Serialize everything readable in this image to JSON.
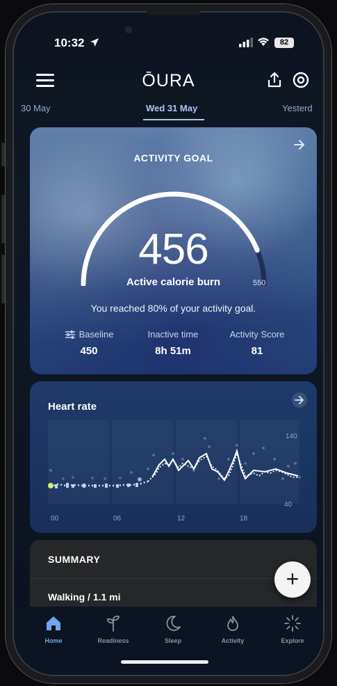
{
  "status_bar": {
    "time": "10:32",
    "battery": "82"
  },
  "header": {
    "logo": "ŌURA"
  },
  "dates": {
    "previous": "30 May",
    "current": "Wed 31 May",
    "next": "Yesterd"
  },
  "activity_goal": {
    "title": "ACTIVITY GOAL",
    "value": "456",
    "unit_label": "Active calorie burn",
    "min": "0",
    "max": "550",
    "progress": 0.83,
    "message": "You reached 80% of your activity goal.",
    "stats": [
      {
        "label": "Baseline",
        "value": "450"
      },
      {
        "label": "Inactive time",
        "value": "8h 51m"
      },
      {
        "label": "Activity Score",
        "value": "81"
      }
    ]
  },
  "heart_rate": {
    "title": "Heart rate",
    "y_max_label": "140",
    "y_min_label": "40",
    "x_labels": [
      "00",
      "06",
      "12",
      "18"
    ]
  },
  "summary": {
    "title": "SUMMARY",
    "row": "Walking / 1.1 mi"
  },
  "fab": {
    "label": "+"
  },
  "nav": [
    {
      "label": "Home",
      "icon": "home-icon",
      "active": true
    },
    {
      "label": "Readiness",
      "icon": "readiness-icon",
      "active": false
    },
    {
      "label": "Sleep",
      "icon": "sleep-icon",
      "active": false
    },
    {
      "label": "Activity",
      "icon": "activity-icon",
      "active": false
    },
    {
      "label": "Explore",
      "icon": "explore-icon",
      "active": false
    }
  ],
  "colors": {
    "accent": "#6fa6ea",
    "active_date": "#a9c8f2"
  }
}
